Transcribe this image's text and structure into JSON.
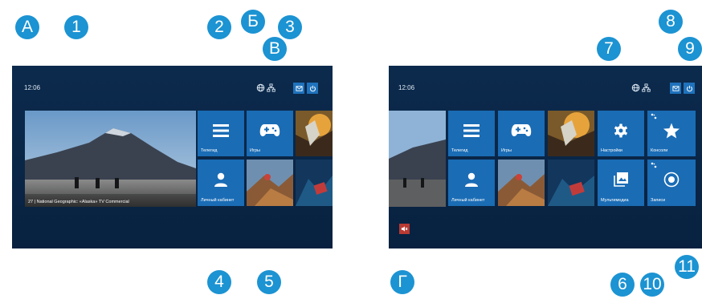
{
  "left_screen": {
    "clock": "12:06",
    "video_caption": "27 | National Geographic: «Alaska» TV Commercial",
    "tiles": {
      "teleguide": "Телегид",
      "games": "Игры",
      "account": "Личный кабинет"
    }
  },
  "right_screen": {
    "clock": "12:06",
    "tiles": {
      "teleguide": "Телегид",
      "games": "Игры",
      "account": "Личный кабинет",
      "settings": "Настройки",
      "consoles": "Консоли",
      "multimedia": "Мультимедиа",
      "recordings": "Записи"
    }
  },
  "markers": {
    "A": "А",
    "B": "Б",
    "V": "В",
    "G": "Г",
    "n1": "1",
    "n2": "2",
    "n3": "3",
    "n4": "4",
    "n5": "5",
    "n6": "6",
    "n7": "7",
    "n8": "8",
    "n9": "9",
    "n10": "10",
    "n11": "11"
  },
  "icons": {
    "status": [
      "globe-icon",
      "network-icon",
      "mail-icon",
      "power-icon"
    ],
    "tiles": [
      "menu-icon",
      "gamepad-icon",
      "user-icon",
      "gear-icon",
      "star-icon",
      "gallery-icon",
      "record-icon"
    ],
    "other": [
      "mute-icon",
      "dots-badge-icon"
    ]
  },
  "colors": {
    "marker": "#1c93d2",
    "tile": "#1a6cb5",
    "screen_background": "#0a2748",
    "status_button": "#1f72bc",
    "mute": "#b83a33"
  }
}
